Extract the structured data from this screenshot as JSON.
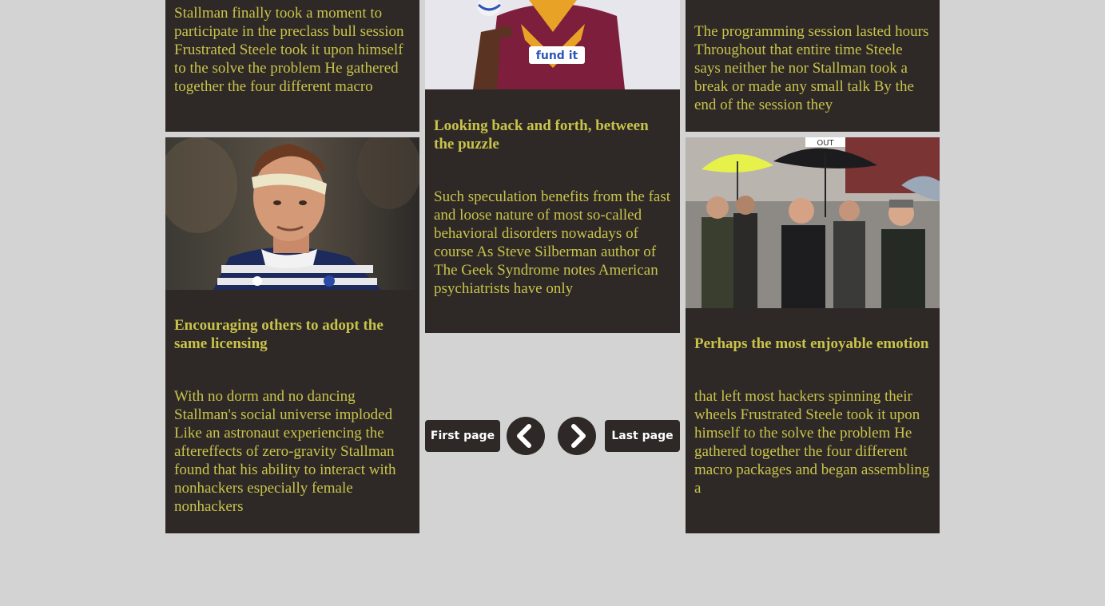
{
  "column_left": {
    "top_card_text": "Stallman finally took a moment to participate in the preclass bull session Frustrated Steele took it upon himself to the solve the problem He gathered together the four different macro",
    "card_title": "Encouraging others to adopt the same licensing",
    "card_text": "With no dorm and no dancing Stallman's social universe imploded Like an astronaut experiencing the aftereffects of zero-gravity Stallman found that his ability to interact with nonhackers especially female nonhackers"
  },
  "column_middle": {
    "card_title": "Looking back and forth, between the puzzle",
    "card_text": "Such speculation benefits from the fast and loose nature of most so-called behavioral disorders nowadays of course As Steve Silberman author of The Geek Syndrome notes American psychiatrists have only",
    "jersey_text": "fund it"
  },
  "column_right": {
    "top_card_text": "The programming session lasted hours Throughout that entire time Steele says neither he nor Stallman took a break or made any small talk By the end of the session they",
    "card_title": "Perhaps the most enjoyable emotion",
    "card_text": "that left most hackers spinning their wheels Frustrated Steele took it upon himself to the solve the problem He gathered together the four different macro packages and began assembling a",
    "sign_text": "OUT"
  },
  "pagination": {
    "first_label": "First page",
    "last_label": "Last page",
    "prev_icon": "chevron-left-icon",
    "next_icon": "chevron-right-icon"
  },
  "colors": {
    "background": "#d3d3d3",
    "card": "#2e2927",
    "text": "#c9c34a",
    "button_text": "#ffffff"
  }
}
